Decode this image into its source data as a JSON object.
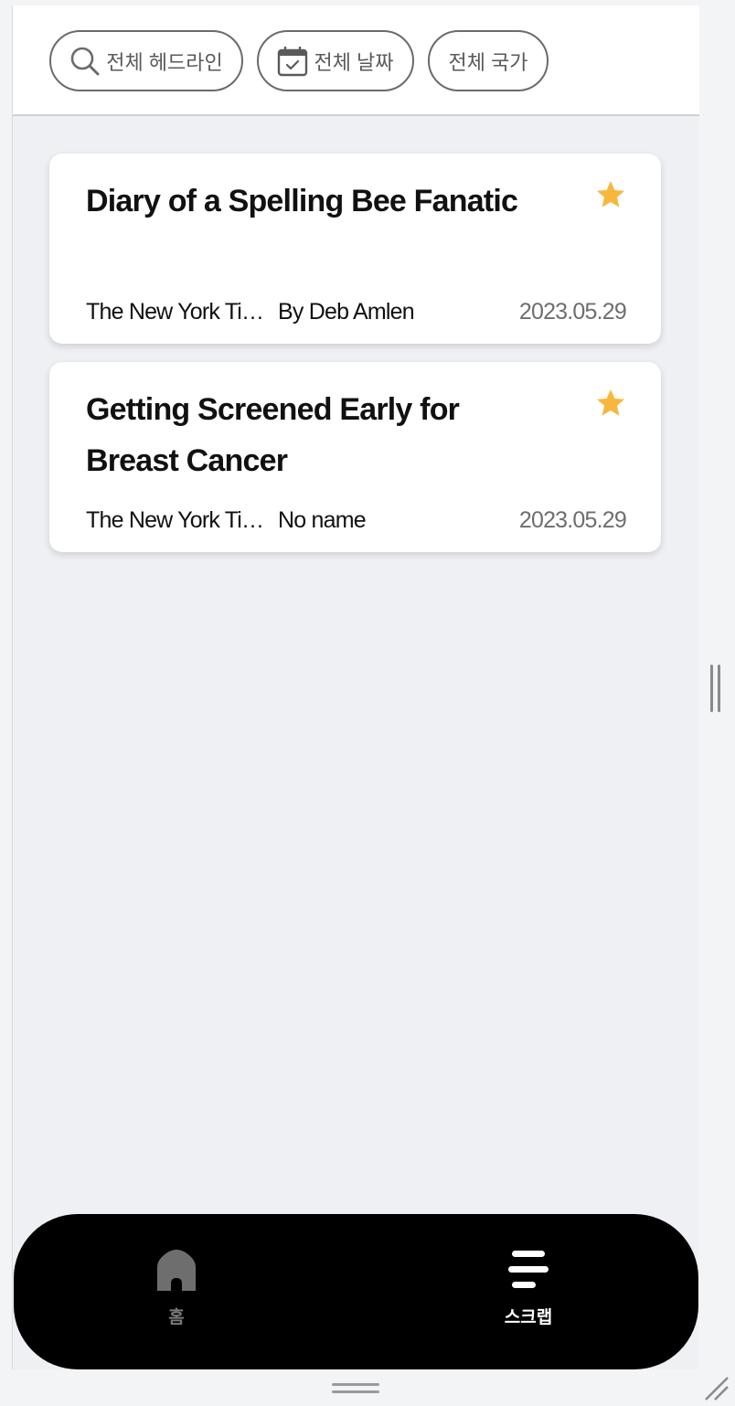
{
  "filters": {
    "headline_label": "전체 헤드라인",
    "date_label": "전체 날짜",
    "country_label": "전체 국가",
    "headline_icon": "search-icon",
    "date_icon": "calendar-icon"
  },
  "articles": [
    {
      "title": "Diary of a Spelling Bee Fanatic",
      "source": "The New York Times",
      "author": "By Deb Amlen",
      "date": "2023.05.29",
      "starred": true
    },
    {
      "title": "Getting Screened Early for Breast Cancer",
      "source": "The New York Times",
      "author": "No name",
      "date": "2023.05.29",
      "starred": true
    }
  ],
  "nav": {
    "home_label": "홈",
    "scrap_label": "스크랩",
    "active": "scrap"
  },
  "colors": {
    "star": "#f6b73c",
    "nav_background": "#000000",
    "nav_active": "#ffffff",
    "nav_inactive": "#7a7a7a",
    "page_background": "#eff0f4"
  }
}
